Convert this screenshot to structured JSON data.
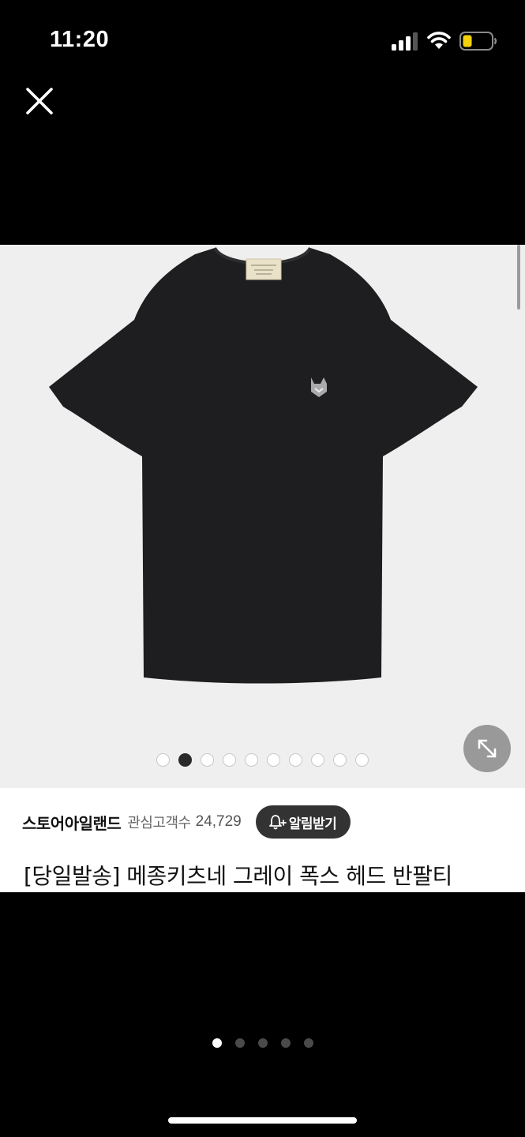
{
  "status_bar": {
    "time": "11:20"
  },
  "icons": {
    "close": "close-icon",
    "expand": "expand-diagonal-icon",
    "bell": "bell-plus-icon",
    "signal": "cellular-signal-icon",
    "wifi": "wifi-icon",
    "battery": "battery-low-icon"
  },
  "product": {
    "image_count": 10,
    "active_image_index": 1,
    "store_name": "스토어아일랜드",
    "follower_label": "관심고객수",
    "follower_count": "24,729",
    "notify_label": "알림받기",
    "title": "[당일발송] 메종키츠네 그레이 폭스 헤드 반팔티"
  },
  "pager": {
    "page_count": 5,
    "active_page_index": 0
  },
  "colors": {
    "background": "#000000",
    "sheet": "#ffffff",
    "image_bg": "#efefef",
    "notify_button": "#333333",
    "battery_fill": "#f5d10a"
  }
}
